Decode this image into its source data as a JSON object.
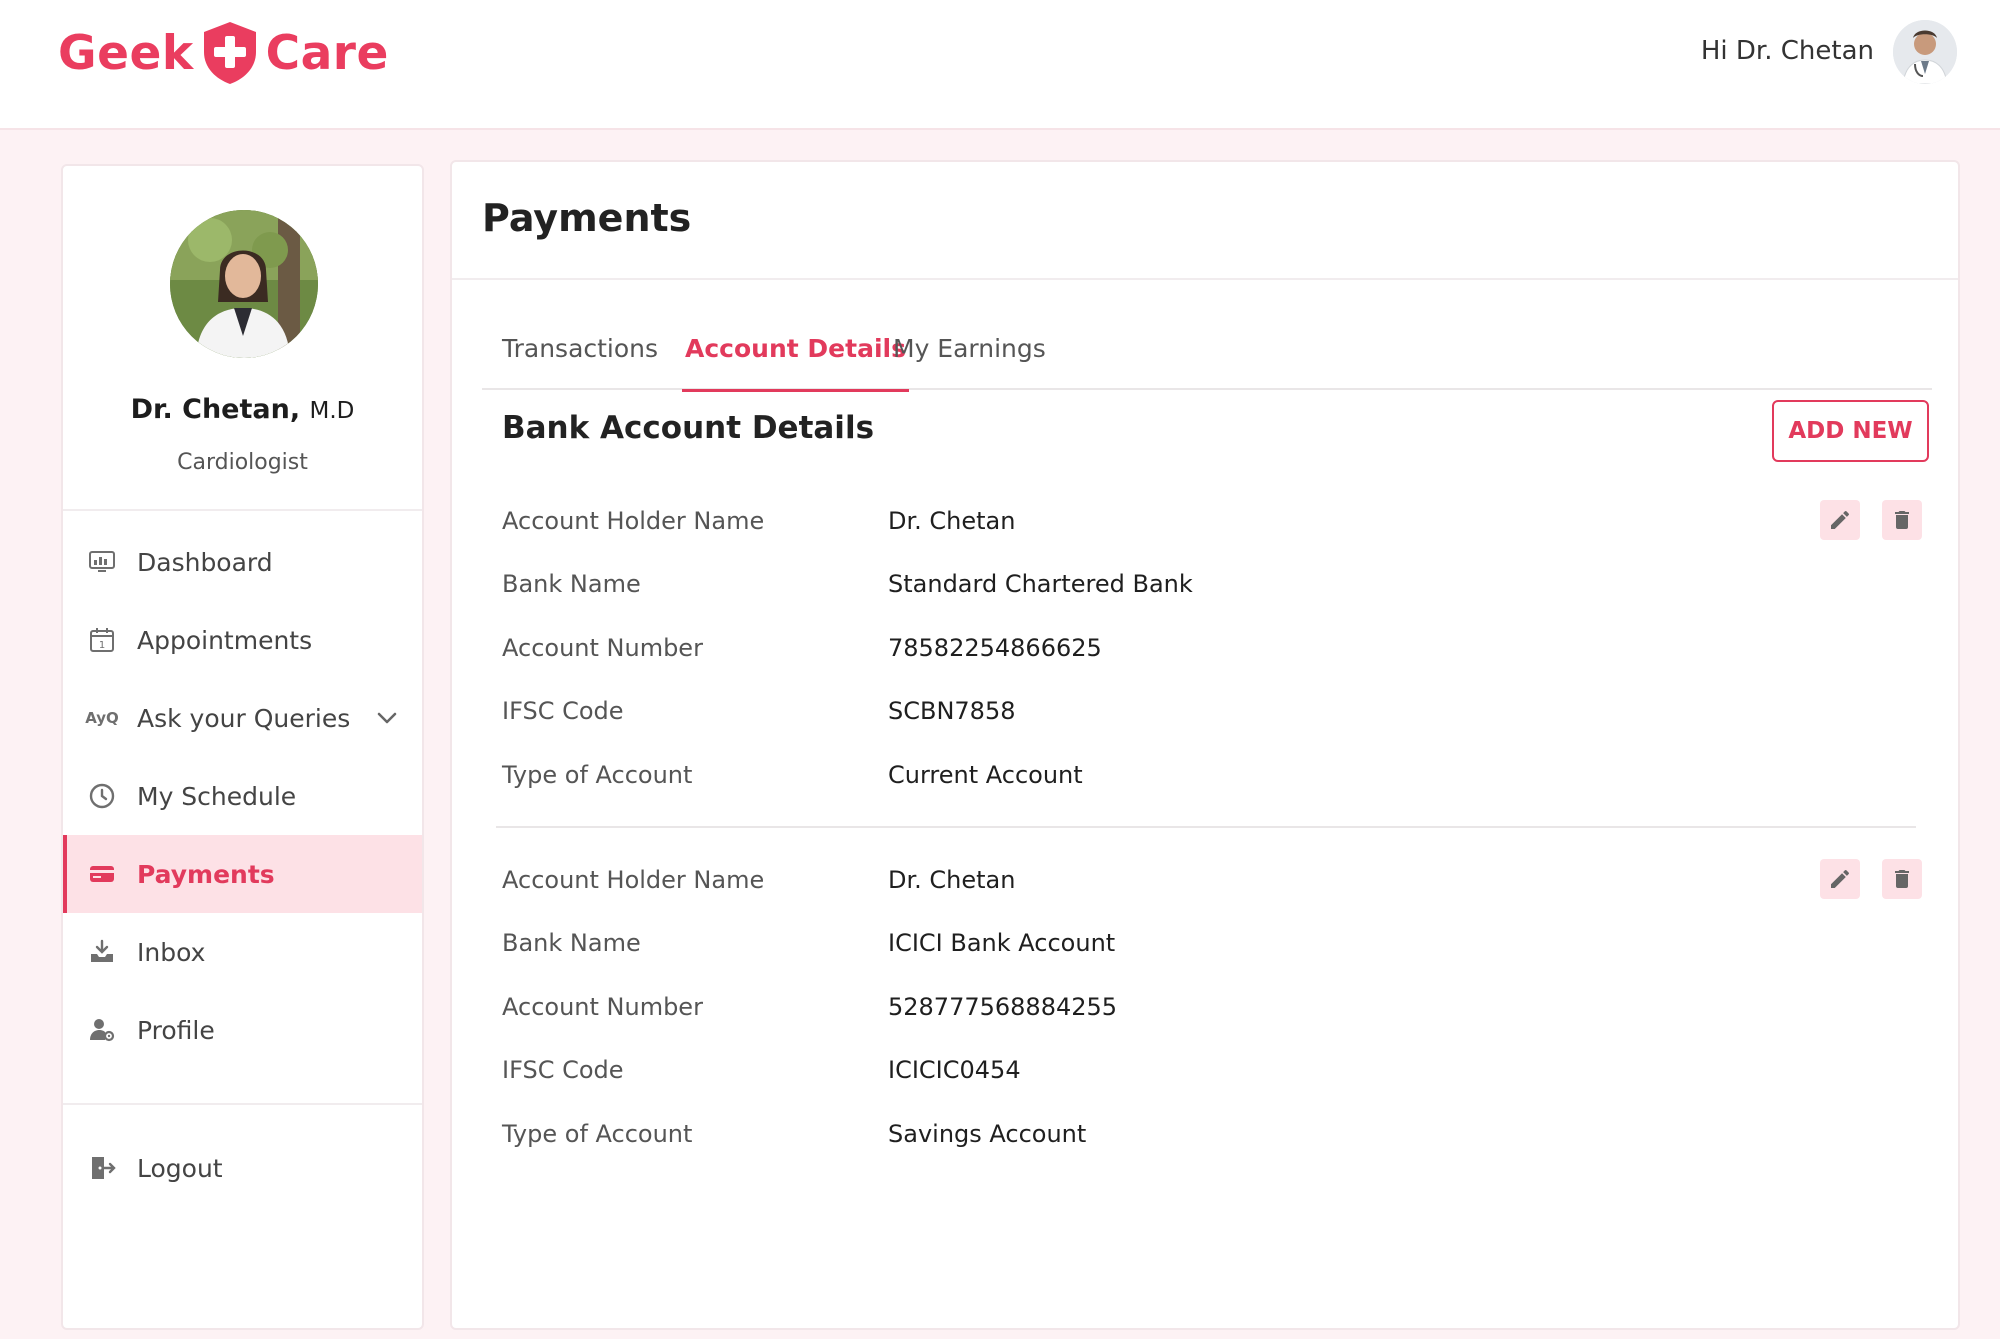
{
  "brand": {
    "part1": "Geek",
    "part2": "Care",
    "accent": "#ea3d5f"
  },
  "header": {
    "greeting": "Hi Dr. Chetan"
  },
  "sidebar": {
    "doctor_name": "Dr. Chetan,",
    "degree": "M.D",
    "specialty": "Cardiologist",
    "items": [
      {
        "label": "Dashboard",
        "icon": "dashboard-icon"
      },
      {
        "label": "Appointments",
        "icon": "calendar-icon"
      },
      {
        "label": "Ask your Queries",
        "icon": "ayq-icon"
      },
      {
        "label": "My Schedule",
        "icon": "clock-icon"
      },
      {
        "label": "Payments",
        "icon": "card-icon"
      },
      {
        "label": "Inbox",
        "icon": "inbox-icon"
      },
      {
        "label": "Profile",
        "icon": "profile-settings-icon"
      }
    ],
    "logout": "Logout",
    "ayq_glyph": "AyQ"
  },
  "main": {
    "title": "Payments",
    "tabs": [
      {
        "label": "Transactions"
      },
      {
        "label": "Account Details"
      },
      {
        "label": "My Earnings"
      }
    ],
    "active_tab": "Account Details",
    "section_title": "Bank Account Details",
    "add_button": "ADD NEW",
    "labels": {
      "holder": "Account Holder Name",
      "bank": "Bank Name",
      "number": "Account Number",
      "ifsc": "IFSC Code",
      "type": "Type of Account"
    },
    "accounts": [
      {
        "holder": "Dr. Chetan",
        "bank": "Standard Chartered Bank",
        "number": "78582254866625",
        "ifsc": "SCBN7858",
        "type": "Current Account"
      },
      {
        "holder": "Dr. Chetan",
        "bank": "ICICI Bank Account",
        "number": "528777568884255",
        "ifsc": "ICICIC0454",
        "type": "Savings Account"
      }
    ]
  }
}
